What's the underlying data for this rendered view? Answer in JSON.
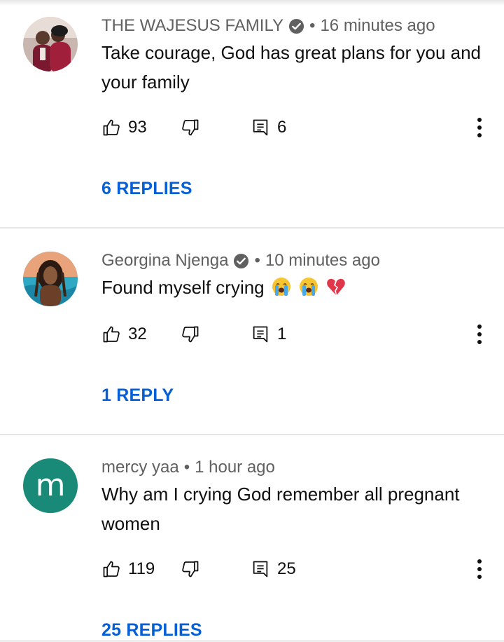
{
  "comments": [
    {
      "author": "THE WAJESUS FAMILY",
      "verified": true,
      "time": "16 minutes ago",
      "text": "Take courage, God has great plans for you and your family",
      "likes": "93",
      "replies_count": "6",
      "replies_label": "6 REPLIES",
      "avatar": "couple-photo"
    },
    {
      "author": "Georgina Njenga",
      "verified": true,
      "time": "10 minutes ago",
      "text": "Found myself crying",
      "emojis": [
        "loudly-crying-face-icon",
        "loudly-crying-face-icon",
        "broken-heart-icon"
      ],
      "likes": "32",
      "replies_count": "1",
      "replies_label": "1 REPLY",
      "avatar": "woman-photo"
    },
    {
      "author": "mercy yaa",
      "verified": false,
      "time": "1 hour ago",
      "text": "Why am I crying God remember all pregnant women",
      "likes": "119",
      "replies_count": "25",
      "replies_label": "25 REPLIES",
      "avatar_letter": "m",
      "avatar_color": "#1a8a78"
    }
  ],
  "separator": "•",
  "colors": {
    "link": "#065fd4",
    "meta": "#606060",
    "text": "#0f0f0f",
    "divider": "#e5e5e5"
  }
}
